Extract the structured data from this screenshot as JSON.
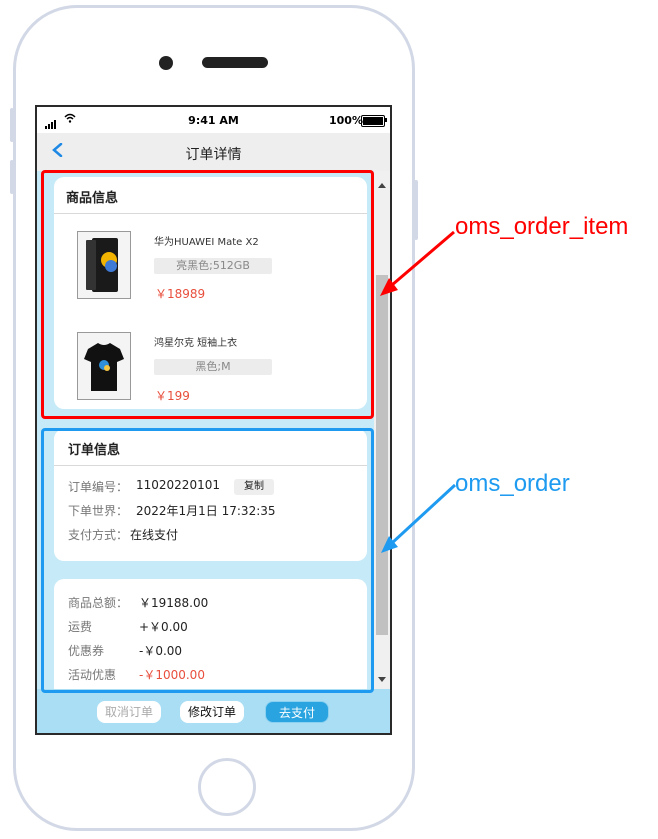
{
  "status_bar": {
    "time": "9:41 AM",
    "battery": "100%"
  },
  "nav": {
    "title": "订单详情"
  },
  "product_section": {
    "title": "商品信息",
    "items": [
      {
        "name": "华为HUAWEI Mate X2",
        "spec": "亮黑色;512GB",
        "price": "￥18989"
      },
      {
        "name": "鸿星尔克 短袖上衣",
        "spec": "黑色;M",
        "price": "￥199"
      }
    ]
  },
  "order_section": {
    "title": "订单信息",
    "order_no_label": "订单编号：",
    "order_no": "11020220101",
    "copy_label": "复制",
    "time_label": "下单世界：",
    "time_value": "2022年1月1日 17:32:35",
    "pay_label": "支付方式：",
    "pay_value": "在线支付"
  },
  "amount_section": {
    "rows": [
      {
        "label": "商品总额：",
        "value": "￥19188.00"
      },
      {
        "label": "运费",
        "value": "+￥0.00"
      },
      {
        "label": "优惠券",
        "value": "-￥0.00"
      },
      {
        "label": "活动优惠",
        "value": "-￥1000.00"
      }
    ]
  },
  "bottom_bar": {
    "cancel": "取消订单",
    "modify": "修改订单",
    "pay": "去支付"
  },
  "annotations": {
    "item_label": "oms_order_item",
    "order_label": "oms_order"
  },
  "colors": {
    "price_red": "#e84f3d",
    "annotation_red": "#ff0000",
    "annotation_blue": "#1e9bf0",
    "content_bg": "#c6eaf7",
    "pay_button": "#2aa4e0"
  }
}
